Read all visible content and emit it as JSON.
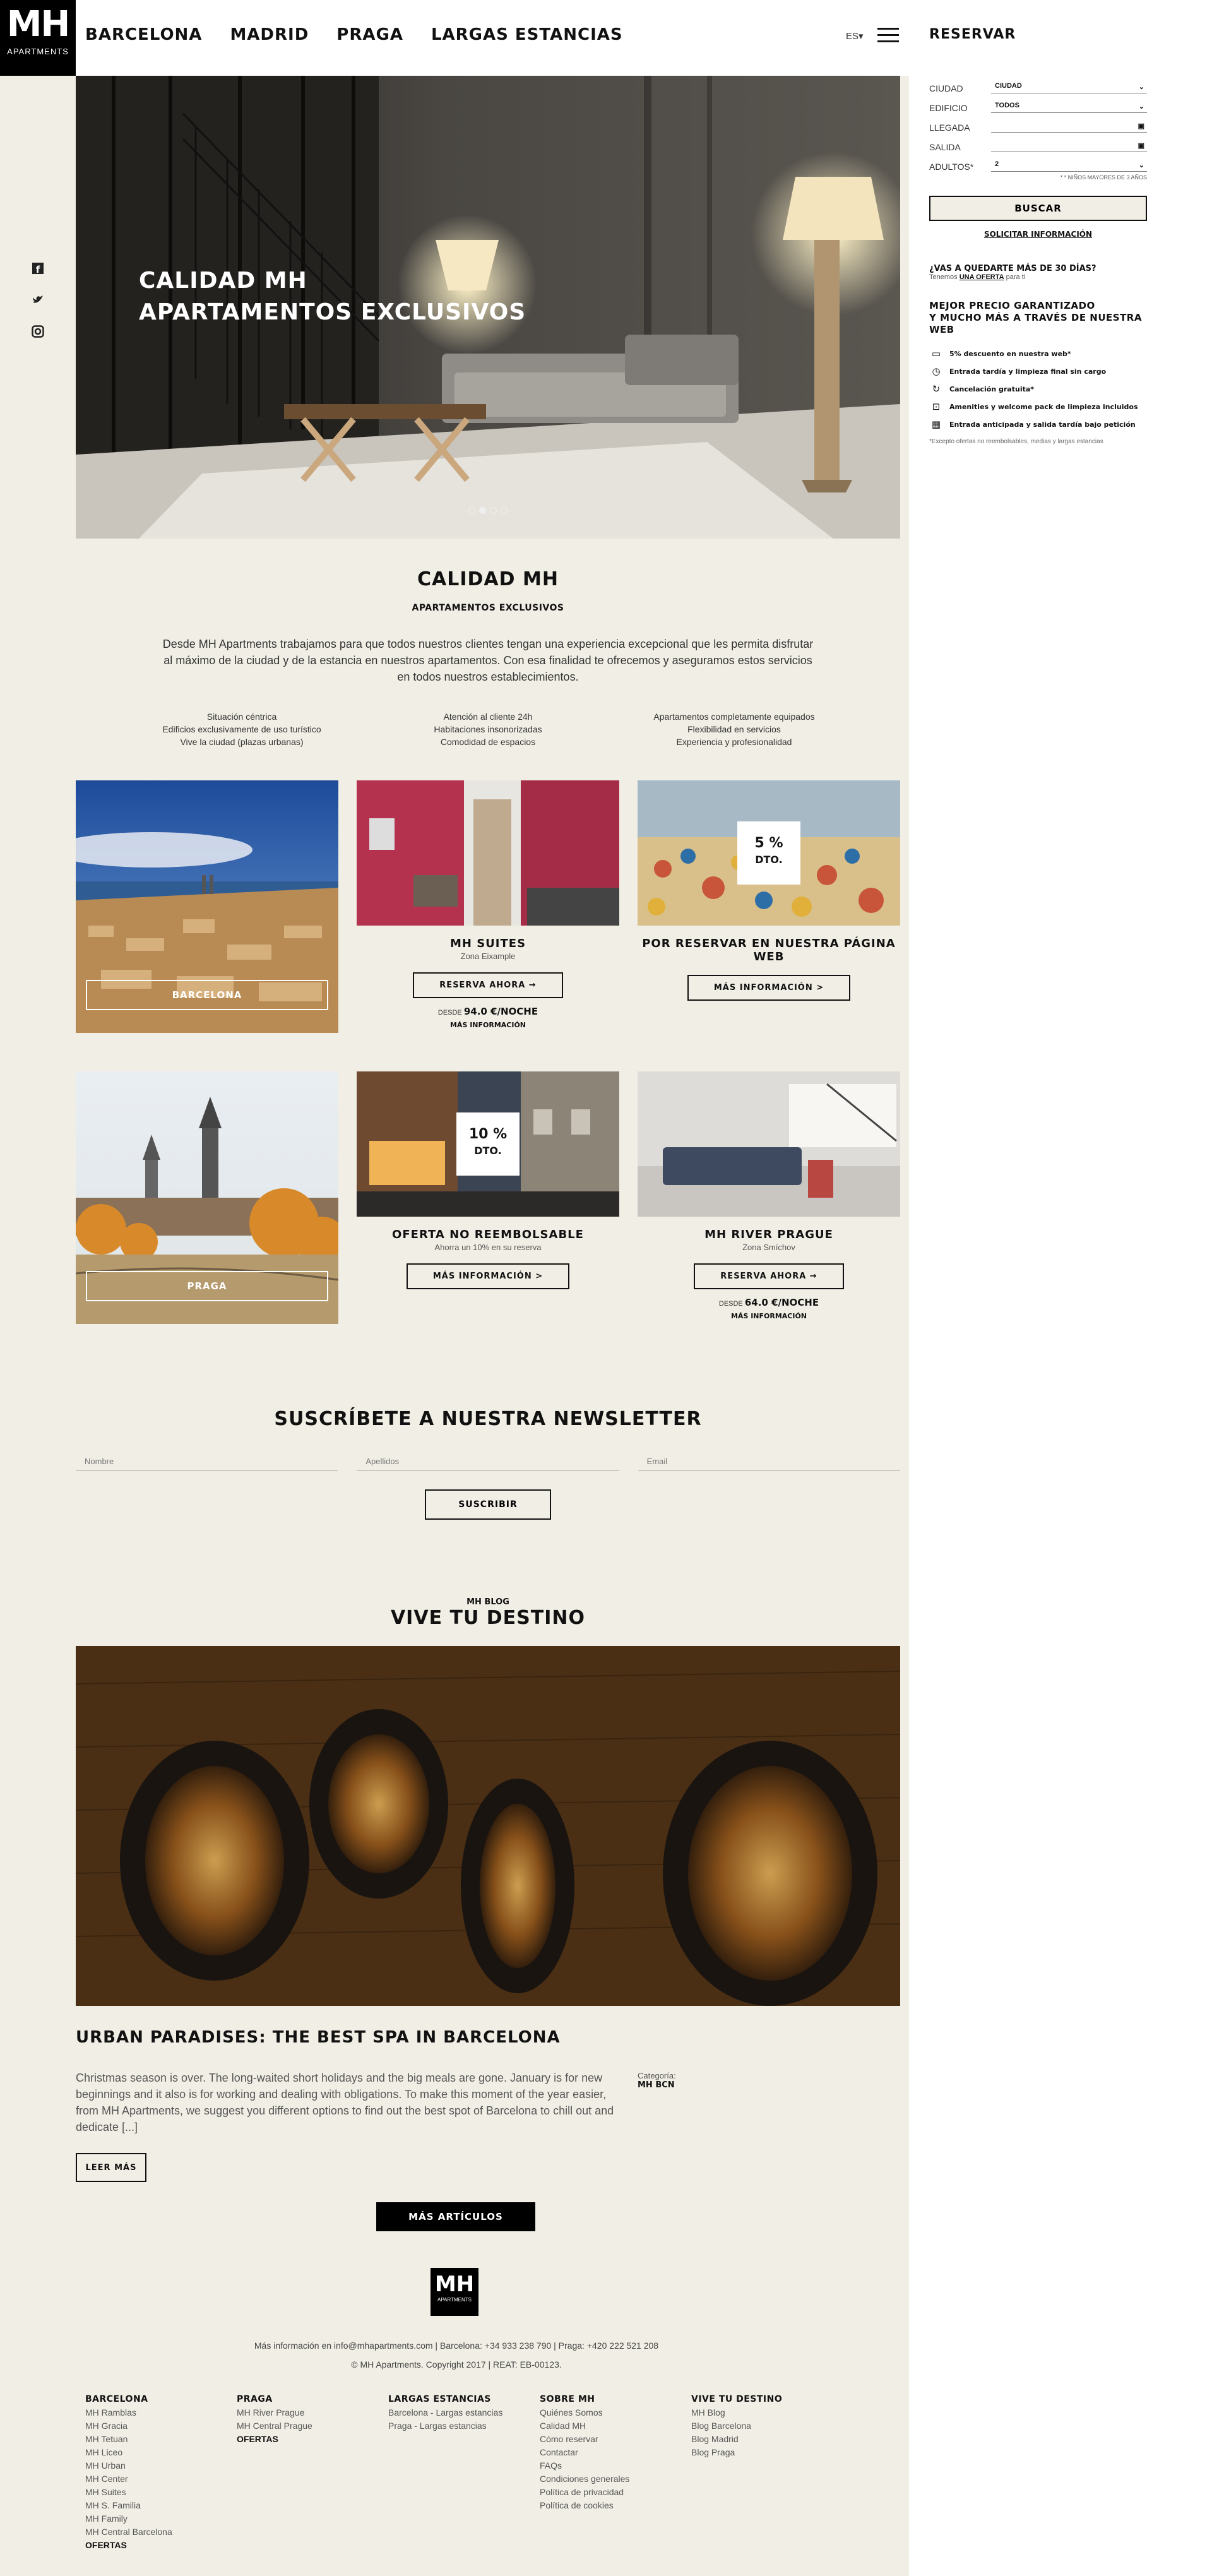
{
  "logo": {
    "mark": "MH",
    "sub": "APARTMENTS"
  },
  "nav": {
    "items": [
      "BARCELONA",
      "MADRID",
      "PRAGA",
      "LARGAS ESTANCIAS"
    ],
    "lang": "ES",
    "reserve": "RESERVAR"
  },
  "hero": {
    "line1": "CALIDAD MH",
    "line2": "APARTAMENTOS EXCLUSIVOS",
    "slides": 4,
    "active_slide": 2
  },
  "intro": {
    "title": "CALIDAD MH",
    "subtitle": "APARTAMENTOS EXCLUSIVOS",
    "text": "Desde MH Apartments trabajamos para que todos nuestros clientes tengan una experiencia excepcional que les permita disfrutar al máximo de la ciudad y de la estancia en nuestros apartamentos. Con esa finalidad te ofrecemos y aseguramos estos servicios en todos nuestros establecimientos.",
    "col1": [
      "Situación céntrica",
      "Edificios exclusivamente de uso turístico",
      "Vive la ciudad (plazas urbanas)"
    ],
    "col2": [
      "Atención al cliente 24h",
      "Habitaciones insonorizadas",
      "Comodidad de espacios"
    ],
    "col3": [
      "Apartamentos completamente equipados",
      "Flexibilidad en servicios",
      "Experiencia y profesionalidad"
    ]
  },
  "cards": {
    "barcelona": {
      "label": "BARCELONA"
    },
    "suites": {
      "title": "MH SUITES",
      "zone": "Zona Eixample",
      "button": "RESERVA AHORA →",
      "from": "DESDE",
      "price": "94.0 €/NOCHE",
      "more": "MÁS INFORMACIÓN"
    },
    "web": {
      "discount": "5 %",
      "dto": "DTO.",
      "title": "POR RESERVAR EN NUESTRA PÁGINA WEB",
      "button": "MÁS INFORMACIÓN >"
    },
    "praga": {
      "label": "PRAGA"
    },
    "nonref": {
      "discount": "10 %",
      "dto": "DTO.",
      "title": "OFERTA NO REEMBOLSABLE",
      "zone": "Ahorra un 10% en su reserva",
      "button": "MÁS INFORMACIÓN >"
    },
    "river": {
      "title": "MH RIVER PRAGUE",
      "zone": "Zona Smíchov",
      "button": "RESERVA AHORA →",
      "from": "DESDE",
      "price": "64.0 €/NOCHE",
      "more": "MÁS INFORMACIÓN"
    }
  },
  "newsletter": {
    "title": "SUSCRÍBETE A NUESTRA NEWSLETTER",
    "name": "Nombre",
    "surname": "Apellidos",
    "email": "Email",
    "button": "SUSCRIBIR"
  },
  "blog": {
    "kicker": "MH BLOG",
    "title": "VIVE TU DESTINO",
    "post_title": "URBAN PARADISES: THE BEST SPA IN BARCELONA",
    "post_text": "Christmas season is over. The long-waited short holidays and the big meals are gone. January is for new beginnings and it also is for working and dealing with obligations. To make this moment of the year easier, from MH Apartments, we suggest you different options to find out the best spot of Barcelona to chill out and dedicate [...]",
    "cat_label": "Categoría:",
    "cat_value": "MH BCN",
    "read_more": "LEER MÁS",
    "all_articles": "MÁS ARTÍCULOS"
  },
  "footer": {
    "info": "Más información en info@mhapartments.com | Barcelona: +34 933 238 790 | Praga: +420 222 521 208",
    "copyright": "© MH Apartments. Copyright 2017 | REAT: EB-00123.",
    "cols": [
      {
        "title": "BARCELONA",
        "items": [
          "MH Ramblas",
          "MH Gracia",
          "MH Tetuan",
          "MH Liceo",
          "MH Urban",
          "MH Center",
          "MH Suites",
          "MH S. Familia",
          "MH Family",
          "MH Central Barcelona"
        ],
        "bold": "OFERTAS"
      },
      {
        "title": "PRAGA",
        "items": [
          "MH River Prague",
          "MH Central Prague"
        ],
        "bold": "OFERTAS"
      },
      {
        "title": "LARGAS ESTANCIAS",
        "items": [
          "Barcelona - Largas estancias",
          "Praga - Largas estancias"
        ],
        "bold": ""
      },
      {
        "title": "SOBRE MH",
        "items": [
          "Quiénes Somos",
          "Calidad MH",
          "Cómo reservar",
          "Contactar",
          "FAQs",
          "Condiciones generales",
          "Política de privacidad",
          "Política de cookies"
        ],
        "bold": ""
      },
      {
        "title": "VIVE TU DESTINO",
        "items": [
          "MH Blog",
          "Blog Barcelona",
          "Blog Madrid",
          "Blog Praga"
        ],
        "bold": ""
      }
    ]
  },
  "booking": {
    "ciudad_label": "CIUDAD",
    "ciudad_value": "CIUDAD",
    "edificio_label": "EDIFICIO",
    "edificio_value": "TODOS",
    "llegada_label": "LLEGADA",
    "salida_label": "SALIDA",
    "adultos_label": "ADULTOS*",
    "adultos_value": "2",
    "note": "* * NIÑOS MAYORES DE 3 AÑOS",
    "search": "BUSCAR",
    "request": "SOLICITAR INFORMACIÓN",
    "stay_q": "¿VAS A QUEDARTE MÁS DE 30 DÍAS?",
    "stay_pre": "Tenemos",
    "stay_link": "UNA OFERTA",
    "stay_post": "para ti",
    "best1": "MEJOR PRECIO GARANTIZADO",
    "best2": "Y MUCHO MÁS A TRAVÉS DE NUESTRA WEB",
    "benefits": [
      "5% descuento en nuestra web*",
      "Entrada tardía y limpieza final sin cargo",
      "Cancelación gratuita*",
      "Amenities y welcome pack de limpieza incluidos",
      "Entrada anticipada y salida tardía bajo petición"
    ],
    "fine": "*Excepto ofertas no reembolsables, medias y largas estancias"
  }
}
